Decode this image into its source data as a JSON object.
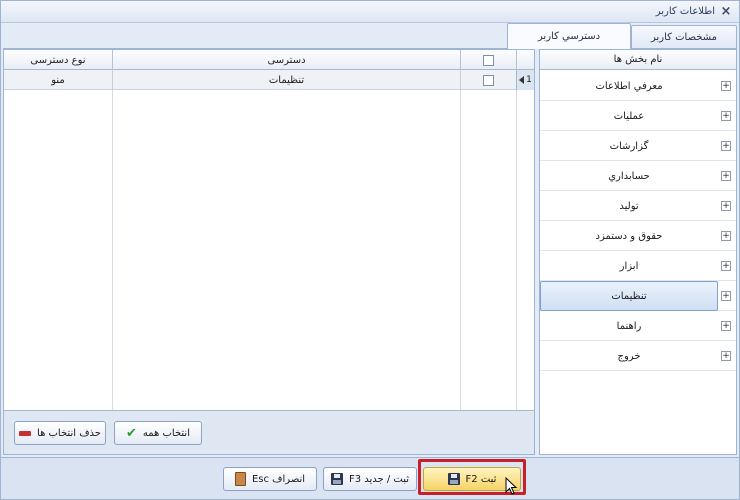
{
  "window": {
    "title": "اطلاعات کاربر",
    "close_glyph": "×"
  },
  "tabs": [
    {
      "label": "مشخصات کاربر",
      "active": false
    },
    {
      "label": "دسترسي کاربر",
      "active": true
    }
  ],
  "grid": {
    "columns": {
      "access_type": "نوع دسترسی",
      "access": "دسترسی"
    },
    "rows": [
      {
        "index": "1",
        "access": "تنظيمات",
        "access_type": "منو"
      }
    ]
  },
  "grid_actions": {
    "select_all": "انتخاب همه",
    "remove_selection": "حذف انتخاب ها"
  },
  "tree": {
    "header": "نام بخش ها",
    "items": [
      {
        "label": "معرفي اطلاعات",
        "selected": false
      },
      {
        "label": "عمليات",
        "selected": false
      },
      {
        "label": "گزارشات",
        "selected": false
      },
      {
        "label": "حسابداري",
        "selected": false
      },
      {
        "label": "توليد",
        "selected": false
      },
      {
        "label": "حقوق و دستمزد",
        "selected": false
      },
      {
        "label": "ابزار",
        "selected": false
      },
      {
        "label": "تنظيمات",
        "selected": true
      },
      {
        "label": "راهنما",
        "selected": false
      },
      {
        "label": "خروج",
        "selected": false
      }
    ]
  },
  "footer": {
    "save": "ثبت F2",
    "save_new": "ثبت / جدید F3",
    "cancel": "انصراف Esc"
  },
  "colors": {
    "highlight": "#c8202a",
    "selected_item": "#cfdff3",
    "save_button": "#f6d365"
  }
}
